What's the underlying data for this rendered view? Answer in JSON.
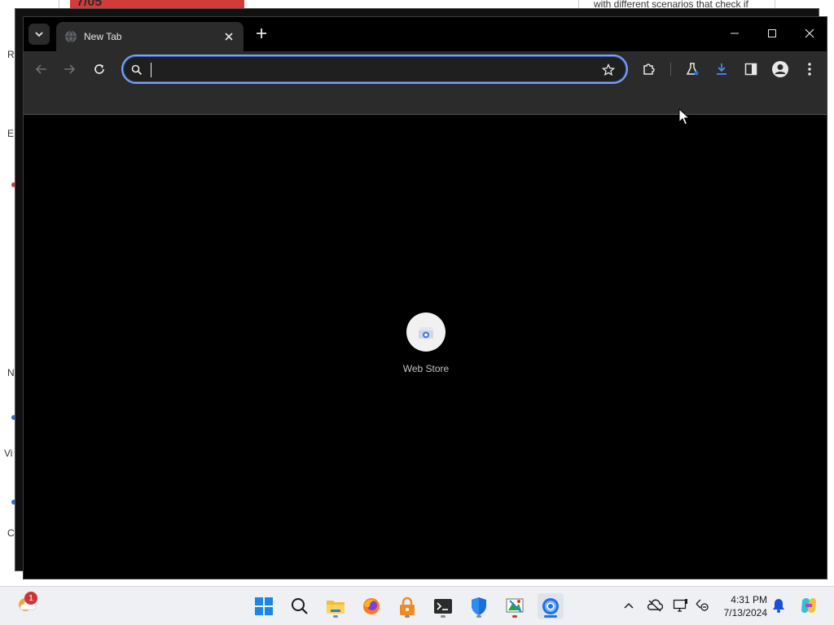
{
  "background": {
    "red_banner_text": "7/05",
    "snippet": "with different scenarios that check if",
    "side_letters": [
      "R",
      "E",
      "N",
      "Vi",
      "C"
    ]
  },
  "browser": {
    "tab": {
      "title": "New Tab"
    },
    "window_controls": [
      "minimize-icon",
      "maximize-icon",
      "close-icon"
    ],
    "omnibox": {
      "value": "",
      "placeholder": ""
    },
    "toolbar_icons": [
      "back-arrow-icon",
      "forward-arrow-icon",
      "reload-icon",
      "bookmark-star-icon",
      "extensions-icon",
      "labs-flask-icon",
      "download-icon",
      "side-panel-icon",
      "profile-icon",
      "menu-kebab-icon"
    ],
    "shortcut": {
      "label": "Web Store"
    }
  },
  "taskbar": {
    "weather_badge": "1",
    "apps": [
      "windows-start-icon",
      "search-icon",
      "file-explorer-icon",
      "firefox-icon",
      "keepass-icon",
      "terminal-icon",
      "defender-shield-icon",
      "paint-icon",
      "chrome-icon"
    ],
    "clock": {
      "time": "4:31 PM",
      "date": "7/13/2024"
    },
    "colors": {
      "accent": "#1a73e8",
      "taskbar_bg": "#eef0f3"
    }
  }
}
